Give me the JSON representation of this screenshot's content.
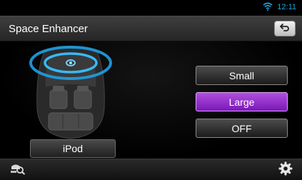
{
  "status": {
    "time": "12:11",
    "wifi_icon": "wifi-icon"
  },
  "header": {
    "title": "Space Enhancer",
    "back_icon": "back-arrow-icon"
  },
  "car": {
    "illustration_icon": "car-interior-icon",
    "source_label": "iPod"
  },
  "options": [
    {
      "label": "Small",
      "selected": false
    },
    {
      "label": "Large",
      "selected": true
    },
    {
      "label": "OFF",
      "selected": false
    }
  ],
  "bottom": {
    "left_icon": "search-sound-icon",
    "right_icon": "gear-icon"
  },
  "colors": {
    "accent": "#19a6e0",
    "selected": "#9a35d0",
    "ring": "#1fa0e6"
  }
}
